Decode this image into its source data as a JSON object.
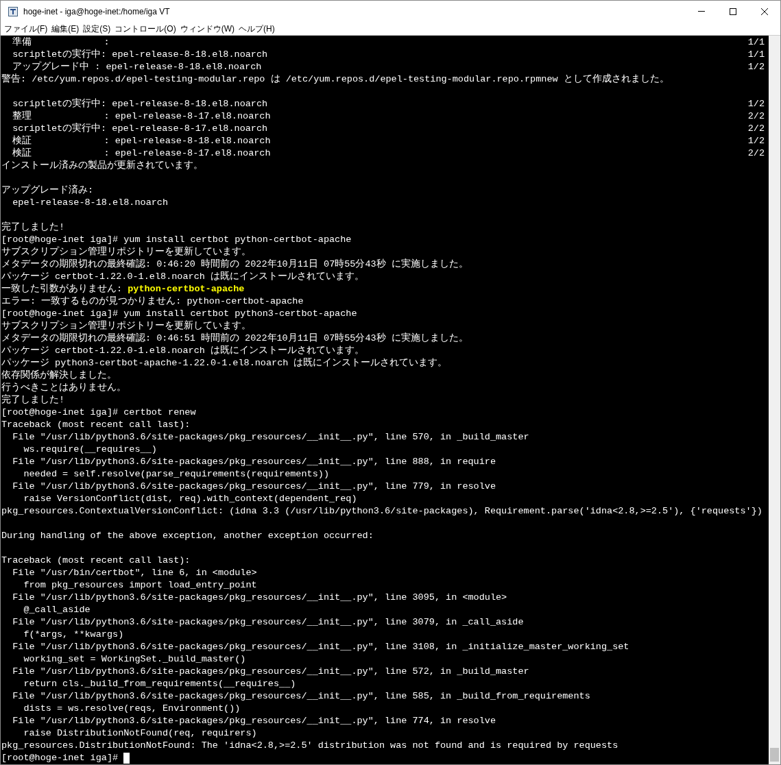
{
  "window": {
    "title": "hoge-inet - iga@hoge-inet:/home/iga VT"
  },
  "menu": [
    "ファイル(F)",
    "編集(E)",
    "設定(S)",
    "コントロール(O)",
    "ウィンドウ(W)",
    "ヘルプ(H)"
  ],
  "terminal": {
    "lines": [
      {
        "text": "  準備             :",
        "right": "1/1"
      },
      {
        "text": "  scriptletの実行中: epel-release-8-18.el8.noarch",
        "right": "1/1"
      },
      {
        "text": "  アップグレード中 : epel-release-8-18.el8.noarch",
        "right": "1/2"
      },
      {
        "text": "警告: /etc/yum.repos.d/epel-testing-modular.repo は /etc/yum.repos.d/epel-testing-modular.repo.rpmnew として作成されました。"
      },
      {
        "kind": "blank"
      },
      {
        "text": "  scriptletの実行中: epel-release-8-18.el8.noarch",
        "right": "1/2"
      },
      {
        "text": "  整理             : epel-release-8-17.el8.noarch",
        "right": "2/2"
      },
      {
        "text": "  scriptletの実行中: epel-release-8-17.el8.noarch",
        "right": "2/2"
      },
      {
        "text": "  検証             : epel-release-8-18.el8.noarch",
        "right": "1/2"
      },
      {
        "text": "  検証             : epel-release-8-17.el8.noarch",
        "right": "2/2"
      },
      {
        "text": "インストール済みの製品が更新されています。"
      },
      {
        "kind": "blank"
      },
      {
        "text": "アップグレード済み:"
      },
      {
        "text": "  epel-release-8-18.el8.noarch"
      },
      {
        "kind": "blank"
      },
      {
        "text": "完了しました!"
      },
      {
        "text": "[root@hoge-inet iga]# yum install certbot python-certbot-apache"
      },
      {
        "text": "サブスクリプション管理リポジトリーを更新しています。"
      },
      {
        "text": "メタデータの期限切れの最終確認: 0:46:20 時間前の 2022年10月11日 07時55分43秒 に実施しました。"
      },
      {
        "text": "パッケージ certbot-1.22.0-1.el8.noarch は既にインストールされています。"
      },
      {
        "text": "一致した引数がありません: ",
        "highlight": "python-certbot-apache"
      },
      {
        "text": "エラー: 一致するものが見つかりません: python-certbot-apache"
      },
      {
        "text": "[root@hoge-inet iga]# yum install certbot python3-certbot-apache"
      },
      {
        "text": "サブスクリプション管理リポジトリーを更新しています。"
      },
      {
        "text": "メタデータの期限切れの最終確認: 0:46:51 時間前の 2022年10月11日 07時55分43秒 に実施しました。"
      },
      {
        "text": "パッケージ certbot-1.22.0-1.el8.noarch は既にインストールされています。"
      },
      {
        "text": "パッケージ python3-certbot-apache-1.22.0-1.el8.noarch は既にインストールされています。"
      },
      {
        "text": "依存関係が解決しました。"
      },
      {
        "text": "行うべきことはありません。"
      },
      {
        "text": "完了しました!"
      },
      {
        "text": "[root@hoge-inet iga]# certbot renew"
      },
      {
        "text": "Traceback (most recent call last):"
      },
      {
        "text": "  File \"/usr/lib/python3.6/site-packages/pkg_resources/__init__.py\", line 570, in _build_master"
      },
      {
        "text": "    ws.require(__requires__)"
      },
      {
        "text": "  File \"/usr/lib/python3.6/site-packages/pkg_resources/__init__.py\", line 888, in require"
      },
      {
        "text": "    needed = self.resolve(parse_requirements(requirements))"
      },
      {
        "text": "  File \"/usr/lib/python3.6/site-packages/pkg_resources/__init__.py\", line 779, in resolve"
      },
      {
        "text": "    raise VersionConflict(dist, req).with_context(dependent_req)"
      },
      {
        "text": "pkg_resources.ContextualVersionConflict: (idna 3.3 (/usr/lib/python3.6/site-packages), Requirement.parse('idna<2.8,>=2.5'), {'requests'})"
      },
      {
        "kind": "blank"
      },
      {
        "text": "During handling of the above exception, another exception occurred:"
      },
      {
        "kind": "blank"
      },
      {
        "text": "Traceback (most recent call last):"
      },
      {
        "text": "  File \"/usr/bin/certbot\", line 6, in <module>"
      },
      {
        "text": "    from pkg_resources import load_entry_point"
      },
      {
        "text": "  File \"/usr/lib/python3.6/site-packages/pkg_resources/__init__.py\", line 3095, in <module>"
      },
      {
        "text": "    @_call_aside"
      },
      {
        "text": "  File \"/usr/lib/python3.6/site-packages/pkg_resources/__init__.py\", line 3079, in _call_aside"
      },
      {
        "text": "    f(*args, **kwargs)"
      },
      {
        "text": "  File \"/usr/lib/python3.6/site-packages/pkg_resources/__init__.py\", line 3108, in _initialize_master_working_set"
      },
      {
        "text": "    working_set = WorkingSet._build_master()"
      },
      {
        "text": "  File \"/usr/lib/python3.6/site-packages/pkg_resources/__init__.py\", line 572, in _build_master"
      },
      {
        "text": "    return cls._build_from_requirements(__requires__)"
      },
      {
        "text": "  File \"/usr/lib/python3.6/site-packages/pkg_resources/__init__.py\", line 585, in _build_from_requirements"
      },
      {
        "text": "    dists = ws.resolve(reqs, Environment())"
      },
      {
        "text": "  File \"/usr/lib/python3.6/site-packages/pkg_resources/__init__.py\", line 774, in resolve"
      },
      {
        "text": "    raise DistributionNotFound(req, requirers)"
      },
      {
        "text": "pkg_resources.DistributionNotFound: The 'idna<2.8,>=2.5' distribution was not found and is required by requests"
      },
      {
        "kind": "prompt",
        "text": "[root@hoge-inet iga]# "
      }
    ]
  }
}
